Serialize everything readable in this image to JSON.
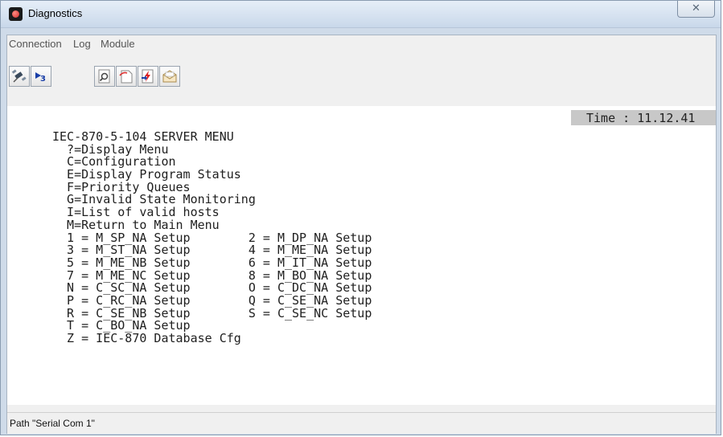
{
  "window": {
    "title": "Diagnostics",
    "close_glyph": "✕"
  },
  "menubar": {
    "items": [
      "Connection",
      "Log",
      "Module"
    ]
  },
  "toolbar": {
    "buttons": [
      {
        "icon": "satellite-disconnect-icon"
      },
      {
        "icon": "dial-connect-icon"
      },
      {
        "icon": "magnify-view-icon"
      },
      {
        "icon": "open-page-icon"
      },
      {
        "icon": "send-lightning-icon"
      },
      {
        "icon": "envelope-icon"
      }
    ]
  },
  "terminal": {
    "time_label": "Time : 11.12.41",
    "lines": [
      "IEC-870-5-104 SERVER MENU",
      "  ?=Display Menu",
      "  C=Configuration",
      "  E=Display Program Status",
      "  F=Priority Queues",
      "  G=Invalid State Monitoring",
      "  I=List of valid hosts",
      "  M=Return to Main Menu",
      "  1 = M_SP_NA Setup        2 = M_DP_NA Setup",
      "  3 = M_ST_NA Setup        4 = M_ME_NA Setup",
      "  5 = M_ME_NB Setup        6 = M_IT_NA Setup",
      "  7 = M_ME_NC Setup        8 = M_BO_NA Setup",
      "  N = C_SC_NA Setup        O = C_DC_NA Setup",
      "  P = C_RC_NA Setup        Q = C_SE_NA Setup",
      "  R = C_SE_NB Setup        S = C_SE_NC Setup",
      "  T = C_BO_NA Setup",
      "  Z = IEC-870 Database Cfg"
    ]
  },
  "status": {
    "path": "Path \"Serial Com 1\""
  },
  "colors": {
    "time_bar": "#c8c8c8",
    "window_frame": "#cfdbe9"
  }
}
